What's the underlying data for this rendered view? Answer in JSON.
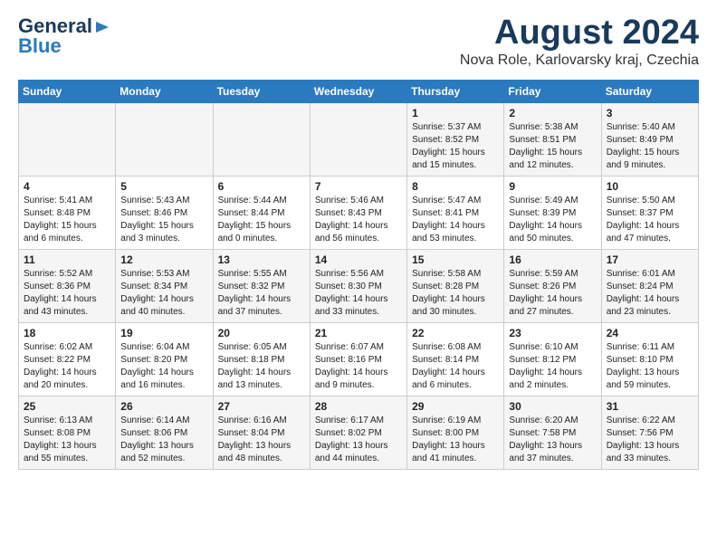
{
  "logo": {
    "line1": "General",
    "line2": "Blue",
    "arrow": "▶"
  },
  "title": "August 2024",
  "subtitle": "Nova Role, Karlovarsky kraj, Czechia",
  "weekdays": [
    "Sunday",
    "Monday",
    "Tuesday",
    "Wednesday",
    "Thursday",
    "Friday",
    "Saturday"
  ],
  "weeks": [
    [
      {
        "day": "",
        "content": ""
      },
      {
        "day": "",
        "content": ""
      },
      {
        "day": "",
        "content": ""
      },
      {
        "day": "",
        "content": ""
      },
      {
        "day": "1",
        "content": "Sunrise: 5:37 AM\nSunset: 8:52 PM\nDaylight: 15 hours\nand 15 minutes."
      },
      {
        "day": "2",
        "content": "Sunrise: 5:38 AM\nSunset: 8:51 PM\nDaylight: 15 hours\nand 12 minutes."
      },
      {
        "day": "3",
        "content": "Sunrise: 5:40 AM\nSunset: 8:49 PM\nDaylight: 15 hours\nand 9 minutes."
      }
    ],
    [
      {
        "day": "4",
        "content": "Sunrise: 5:41 AM\nSunset: 8:48 PM\nDaylight: 15 hours\nand 6 minutes."
      },
      {
        "day": "5",
        "content": "Sunrise: 5:43 AM\nSunset: 8:46 PM\nDaylight: 15 hours\nand 3 minutes."
      },
      {
        "day": "6",
        "content": "Sunrise: 5:44 AM\nSunset: 8:44 PM\nDaylight: 15 hours\nand 0 minutes."
      },
      {
        "day": "7",
        "content": "Sunrise: 5:46 AM\nSunset: 8:43 PM\nDaylight: 14 hours\nand 56 minutes."
      },
      {
        "day": "8",
        "content": "Sunrise: 5:47 AM\nSunset: 8:41 PM\nDaylight: 14 hours\nand 53 minutes."
      },
      {
        "day": "9",
        "content": "Sunrise: 5:49 AM\nSunset: 8:39 PM\nDaylight: 14 hours\nand 50 minutes."
      },
      {
        "day": "10",
        "content": "Sunrise: 5:50 AM\nSunset: 8:37 PM\nDaylight: 14 hours\nand 47 minutes."
      }
    ],
    [
      {
        "day": "11",
        "content": "Sunrise: 5:52 AM\nSunset: 8:36 PM\nDaylight: 14 hours\nand 43 minutes."
      },
      {
        "day": "12",
        "content": "Sunrise: 5:53 AM\nSunset: 8:34 PM\nDaylight: 14 hours\nand 40 minutes."
      },
      {
        "day": "13",
        "content": "Sunrise: 5:55 AM\nSunset: 8:32 PM\nDaylight: 14 hours\nand 37 minutes."
      },
      {
        "day": "14",
        "content": "Sunrise: 5:56 AM\nSunset: 8:30 PM\nDaylight: 14 hours\nand 33 minutes."
      },
      {
        "day": "15",
        "content": "Sunrise: 5:58 AM\nSunset: 8:28 PM\nDaylight: 14 hours\nand 30 minutes."
      },
      {
        "day": "16",
        "content": "Sunrise: 5:59 AM\nSunset: 8:26 PM\nDaylight: 14 hours\nand 27 minutes."
      },
      {
        "day": "17",
        "content": "Sunrise: 6:01 AM\nSunset: 8:24 PM\nDaylight: 14 hours\nand 23 minutes."
      }
    ],
    [
      {
        "day": "18",
        "content": "Sunrise: 6:02 AM\nSunset: 8:22 PM\nDaylight: 14 hours\nand 20 minutes."
      },
      {
        "day": "19",
        "content": "Sunrise: 6:04 AM\nSunset: 8:20 PM\nDaylight: 14 hours\nand 16 minutes."
      },
      {
        "day": "20",
        "content": "Sunrise: 6:05 AM\nSunset: 8:18 PM\nDaylight: 14 hours\nand 13 minutes."
      },
      {
        "day": "21",
        "content": "Sunrise: 6:07 AM\nSunset: 8:16 PM\nDaylight: 14 hours\nand 9 minutes."
      },
      {
        "day": "22",
        "content": "Sunrise: 6:08 AM\nSunset: 8:14 PM\nDaylight: 14 hours\nand 6 minutes."
      },
      {
        "day": "23",
        "content": "Sunrise: 6:10 AM\nSunset: 8:12 PM\nDaylight: 14 hours\nand 2 minutes."
      },
      {
        "day": "24",
        "content": "Sunrise: 6:11 AM\nSunset: 8:10 PM\nDaylight: 13 hours\nand 59 minutes."
      }
    ],
    [
      {
        "day": "25",
        "content": "Sunrise: 6:13 AM\nSunset: 8:08 PM\nDaylight: 13 hours\nand 55 minutes."
      },
      {
        "day": "26",
        "content": "Sunrise: 6:14 AM\nSunset: 8:06 PM\nDaylight: 13 hours\nand 52 minutes."
      },
      {
        "day": "27",
        "content": "Sunrise: 6:16 AM\nSunset: 8:04 PM\nDaylight: 13 hours\nand 48 minutes."
      },
      {
        "day": "28",
        "content": "Sunrise: 6:17 AM\nSunset: 8:02 PM\nDaylight: 13 hours\nand 44 minutes."
      },
      {
        "day": "29",
        "content": "Sunrise: 6:19 AM\nSunset: 8:00 PM\nDaylight: 13 hours\nand 41 minutes."
      },
      {
        "day": "30",
        "content": "Sunrise: 6:20 AM\nSunset: 7:58 PM\nDaylight: 13 hours\nand 37 minutes."
      },
      {
        "day": "31",
        "content": "Sunrise: 6:22 AM\nSunset: 7:56 PM\nDaylight: 13 hours\nand 33 minutes."
      }
    ]
  ]
}
